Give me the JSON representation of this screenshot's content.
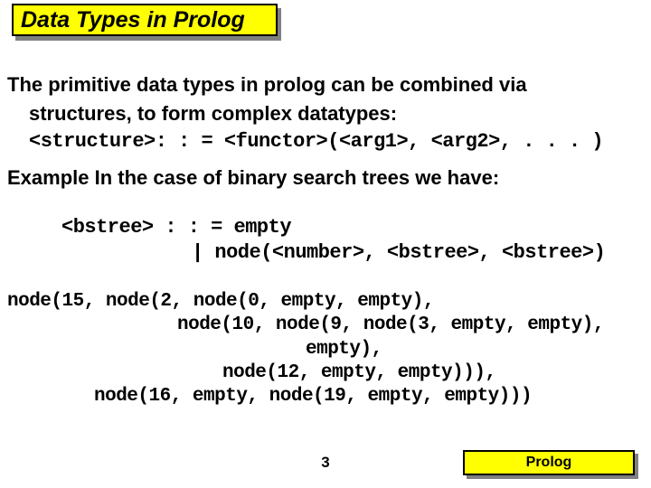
{
  "title": "Data Types in Prolog",
  "intro_line1": "The primitive data types in prolog can be combined via",
  "intro_line2": "structures, to form complex datatypes:",
  "struct_rule": "<structure>: : = <functor>(<arg1>, <arg2>, . . . )",
  "example_label": "Example",
  "example_text": " In the case of binary search trees we have:",
  "grammar_l1": "<bstree> : : = empty",
  "grammar_l2": "| node(<number>, <bstree>, <bstree>)",
  "tree_l1": "node(15, node(2, node(0, empty, empty),",
  "tree_l2": "node(10, node(9, node(3, empty, empty),",
  "tree_l3": "empty),",
  "tree_l4": "node(12, empty, empty))),",
  "tree_l5": "node(16, empty, node(19, empty, empty)))",
  "page_number": "3",
  "footer_label": "Prolog"
}
